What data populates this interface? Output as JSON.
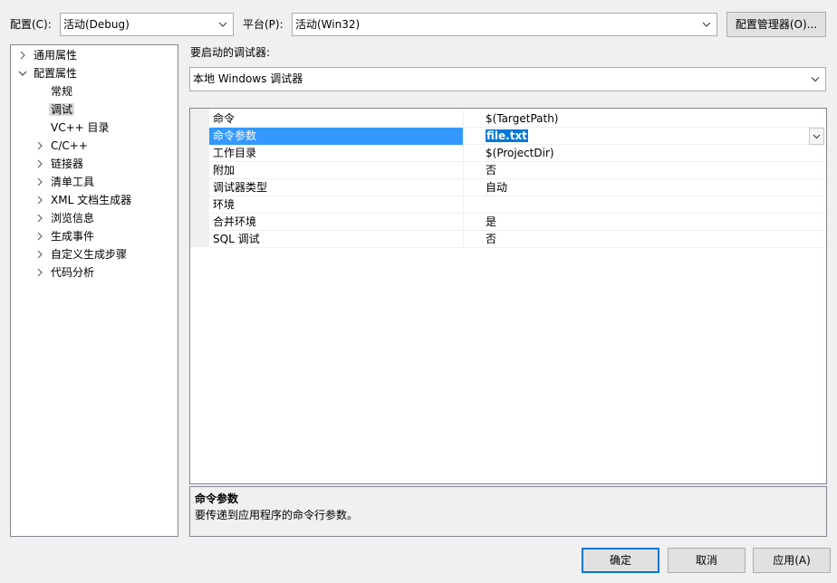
{
  "header": {
    "config_label": "配置(C):",
    "config_value": "活动(Debug)",
    "platform_label": "平台(P):",
    "platform_value": "活动(Win32)",
    "config_manager_button": "配置管理器(O)..."
  },
  "tree": {
    "items": [
      {
        "label": "通用属性"
      },
      {
        "label": "配置属性"
      },
      {
        "label": "常规"
      },
      {
        "label": "调试"
      },
      {
        "label": "VC++ 目录"
      },
      {
        "label": "C/C++"
      },
      {
        "label": "链接器"
      },
      {
        "label": "清单工具"
      },
      {
        "label": "XML 文档生成器"
      },
      {
        "label": "浏览信息"
      },
      {
        "label": "生成事件"
      },
      {
        "label": "自定义生成步骤"
      },
      {
        "label": "代码分析"
      }
    ],
    "selected": "调试"
  },
  "debugger": {
    "label": "要启动的调试器:",
    "value": "本地 Windows 调试器"
  },
  "properties": {
    "rows": [
      {
        "name": "命令",
        "value": "$(TargetPath)"
      },
      {
        "name": "命令参数",
        "value": "file.txt"
      },
      {
        "name": "工作目录",
        "value": "$(ProjectDir)"
      },
      {
        "name": "附加",
        "value": "否"
      },
      {
        "name": "调试器类型",
        "value": "自动"
      },
      {
        "name": "环境",
        "value": ""
      },
      {
        "name": "合并环境",
        "value": "是"
      },
      {
        "name": "SQL 调试",
        "value": "否"
      }
    ],
    "selected": "命令参数"
  },
  "description": {
    "title": "命令参数",
    "text": "要传递到应用程序的命令行参数。"
  },
  "footer": {
    "ok": "确定",
    "cancel": "取消",
    "apply": "应用(A)"
  },
  "colors": {
    "selection": "#3399ff",
    "accent": "#0078d7"
  }
}
